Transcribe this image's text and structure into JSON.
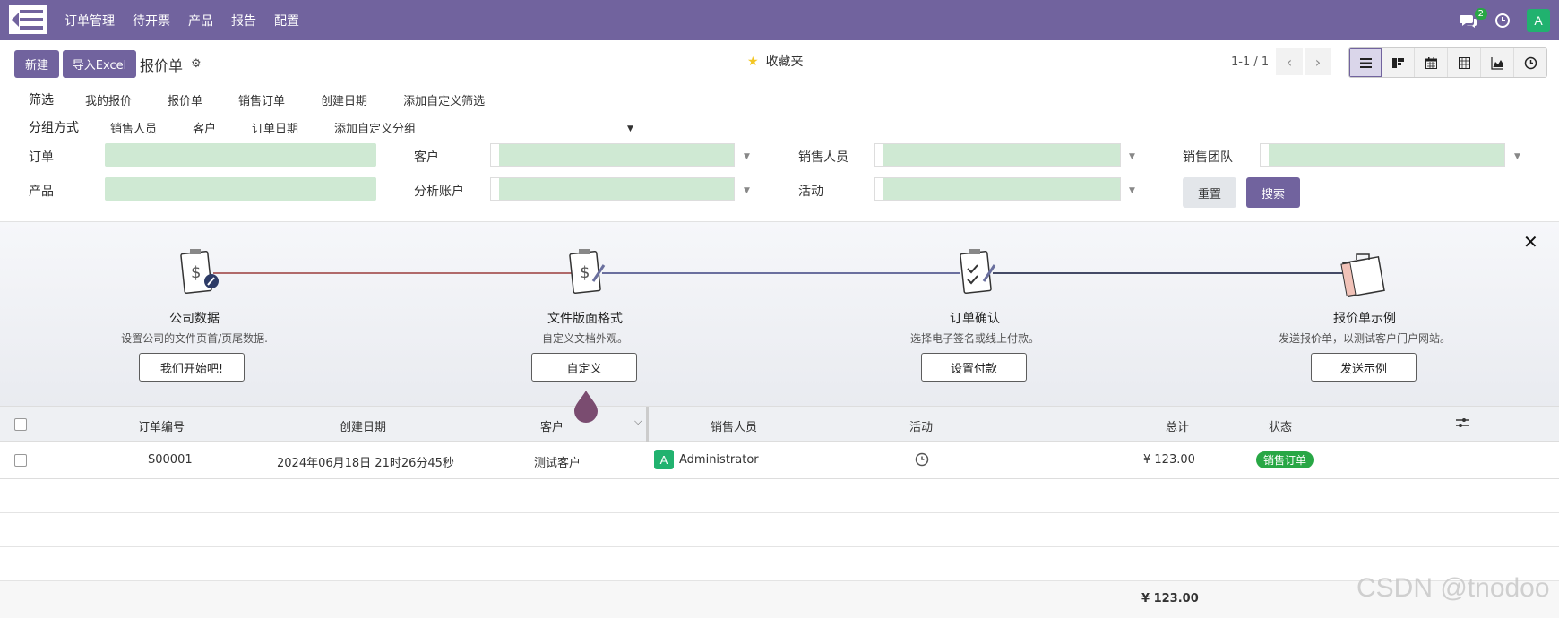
{
  "navbar": {
    "menu": [
      "订单管理",
      "待开票",
      "产品",
      "报告",
      "配置"
    ],
    "chat_count": "2",
    "avatar_letter": "A",
    "icons": [
      "apps-icon",
      "chat-icon",
      "clock-icon"
    ]
  },
  "control": {
    "new_label": "新建",
    "import_label": "导入Excel",
    "title": "报价单",
    "favorites_label": "收藏夹",
    "pager_text": "1-1 / 1",
    "views": [
      "list-view-icon",
      "kanban-view-icon",
      "calendar-view-icon",
      "pivot-view-icon",
      "graph-view-icon",
      "activity-view-icon"
    ]
  },
  "filters": {
    "filter_label": "筛选",
    "filter_items": [
      "我的报价",
      "报价单",
      "销售订单",
      "创建日期",
      "添加自定义筛选"
    ],
    "group_label": "分组方式",
    "group_items": [
      "销售人员",
      "客户",
      "订单日期",
      "添加自定义分组"
    ]
  },
  "search": {
    "order_label": "订单",
    "customer_label": "客户",
    "salesperson_label": "销售人员",
    "team_label": "销售团队",
    "product_label": "产品",
    "analytic_label": "分析账户",
    "activity_label": "活动",
    "reset_label": "重置",
    "search_label": "搜索"
  },
  "onboarding": {
    "steps": [
      {
        "title": "公司数据",
        "desc": "设置公司的文件页首/页尾数据.",
        "button": "我们开始吧!"
      },
      {
        "title": "文件版面格式",
        "desc": "自定义文档外观。",
        "button": "自定义"
      },
      {
        "title": "订单确认",
        "desc": "选择电子签名或线上付款。",
        "button": "设置付款"
      },
      {
        "title": "报价单示例",
        "desc": "发送报价单，以测试客户门户网站。",
        "button": "发送示例"
      }
    ]
  },
  "table": {
    "headers": {
      "number": "订单编号",
      "date": "创建日期",
      "customer": "客户",
      "salesperson": "销售人员",
      "activity": "活动",
      "total": "总计",
      "status": "状态"
    },
    "rows": [
      {
        "number": "S00001",
        "date": "2024年06月18日 21时26分45秒",
        "customer": "测试客户",
        "avatar": "A",
        "salesperson": "Administrator",
        "total": "¥ 123.00",
        "status": "销售订单"
      }
    ],
    "footer_total": "¥ 123.00"
  },
  "watermark": "CSDN @tnodoo"
}
